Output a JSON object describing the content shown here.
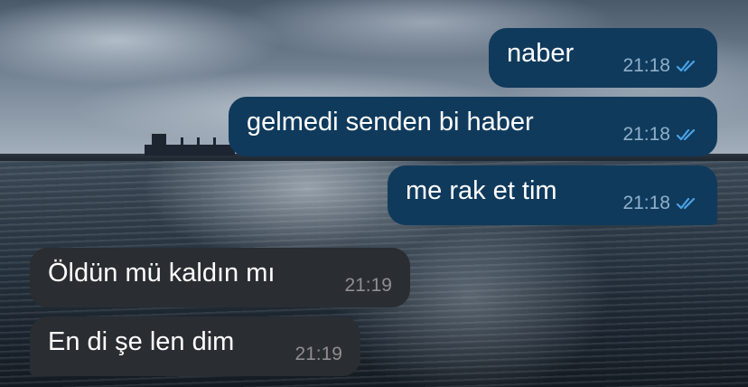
{
  "chat": {
    "messages": [
      {
        "direction": "outgoing",
        "text": "naber",
        "time": "21:18",
        "status_icon": "double-check-icon"
      },
      {
        "direction": "outgoing",
        "text": "gelmedi senden bi haber",
        "time": "21:18",
        "status_icon": "double-check-icon"
      },
      {
        "direction": "outgoing",
        "text": "me rak et tim",
        "time": "21:18",
        "status_icon": "double-check-icon"
      },
      {
        "direction": "incoming",
        "text": "Öldün mü kaldın mı",
        "time": "21:19"
      },
      {
        "direction": "incoming",
        "text": "En di şe len dim",
        "time": "21:19"
      }
    ]
  },
  "colors": {
    "outgoing_bubble": "#0f3a5c",
    "incoming_bubble": "#2a2d31",
    "read_check": "#4aa3e8"
  }
}
